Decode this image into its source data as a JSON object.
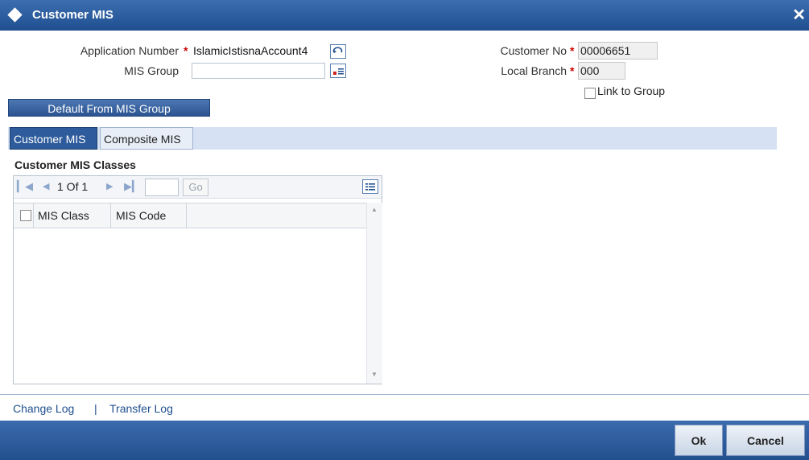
{
  "window": {
    "title": "Customer MIS",
    "close_glyph": "✕"
  },
  "form": {
    "application_number_label": "Application Number",
    "application_number_value": "IslamicIstisnaAccount4",
    "mis_group_label": "MIS Group",
    "mis_group_value": "",
    "customer_no_label": "Customer No",
    "customer_no_value": "00006651",
    "local_branch_label": "Local Branch",
    "local_branch_value": "000",
    "link_to_group_label": "Link to Group",
    "required_mark": "*"
  },
  "default_button_label": "Default From MIS Group",
  "tabs": [
    {
      "label": "Customer MIS",
      "active": true
    },
    {
      "label": "Composite MIS",
      "active": false
    }
  ],
  "section_title": "Customer MIS Classes",
  "pager": {
    "text": "1 Of 1",
    "go_label": "Go"
  },
  "table": {
    "columns": [
      "MIS Class",
      "MIS Code"
    ],
    "rows": []
  },
  "footer_links": {
    "change_log": "Change Log",
    "separator": "|",
    "transfer_log": "Transfer Log"
  },
  "buttons": {
    "ok": "Ok",
    "cancel": "Cancel"
  },
  "colors": {
    "title_bar": "#1f4f8f",
    "active_tab": "#2d5b9b",
    "required": "#d00000",
    "link": "#1f4f8f"
  }
}
